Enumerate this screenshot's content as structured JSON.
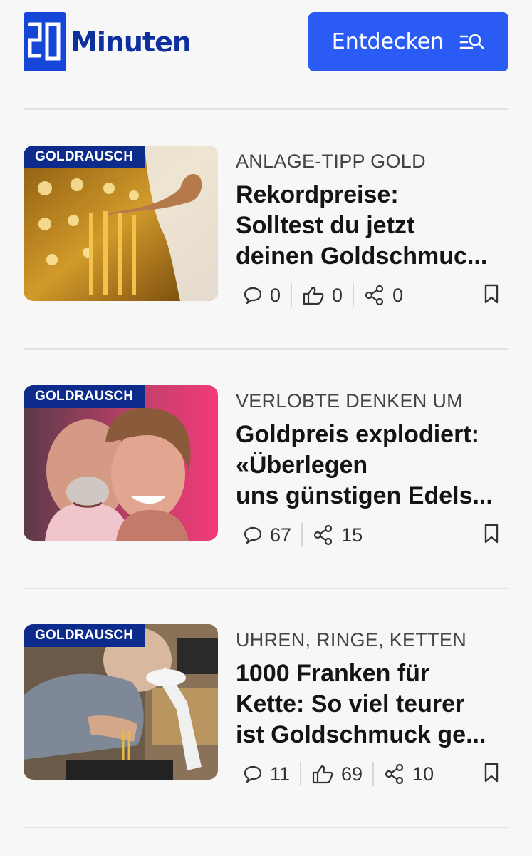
{
  "header": {
    "logo_number": "20",
    "logo_text": "Minuten",
    "discover_label": "Entdecken"
  },
  "articles": [
    {
      "badge": "GOLDRAUSCH",
      "kicker": "ANLAGE-TIPP GOLD",
      "title_lines": [
        "Rekordpreise:",
        "Solltest du jetzt",
        "deinen Goldschmuc..."
      ],
      "comments": "0",
      "likes": "0",
      "shares": "0"
    },
    {
      "badge": "GOLDRAUSCH",
      "kicker": "VERLOBTE DENKEN UM",
      "title_lines": [
        "Goldpreis explodiert:",
        "«Überlegen",
        "uns günstigen Edels..."
      ],
      "comments": "67",
      "shares": "15"
    },
    {
      "badge": "GOLDRAUSCH",
      "kicker": "UHREN, RINGE, KETTEN",
      "title_lines": [
        "1000 Franken für",
        "Kette: So viel teurer",
        "ist Goldschmuck ge..."
      ],
      "comments": "11",
      "likes": "69",
      "shares": "10"
    }
  ],
  "colors": {
    "brand": "#0e2f9e",
    "button": "#2a5cf5",
    "badge": "#0d2b8a"
  },
  "icons": [
    "comment-icon",
    "like-icon",
    "share-icon",
    "bookmark-icon",
    "search-list-icon"
  ]
}
